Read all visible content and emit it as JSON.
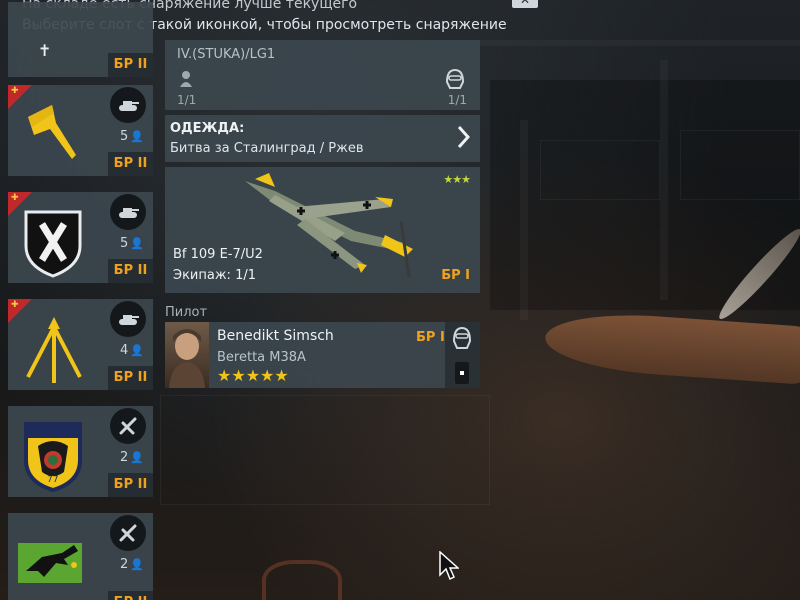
{
  "hint": {
    "line1": "На складе есть снаряжение лучше текущего",
    "line2": "Выберите слот с такой иконкой, чтобы просмотреть снаряжение"
  },
  "slots": [
    {
      "type_icon": "plane-icon",
      "br": "БР II",
      "crew": ""
    },
    {
      "type_icon": "tank-icon",
      "br": "БР II",
      "crew": "5",
      "emblem": "axe-emblem-icon"
    },
    {
      "type_icon": "tank-icon",
      "br": "БР II",
      "crew": "5",
      "emblem": "x-shield-emblem-icon"
    },
    {
      "type_icon": "tank-icon",
      "br": "БР II",
      "crew": "4",
      "emblem": "arrows-emblem-icon"
    },
    {
      "type_icon": "plane-icon",
      "br": "БР II",
      "crew": "2",
      "emblem": "eagle-shield-emblem-icon"
    },
    {
      "type_icon": "plane-icon",
      "br": "БР II",
      "crew": "2",
      "emblem": "bird-flag-emblem-icon"
    }
  ],
  "unit": {
    "name": "IV.(STUKA)/LG1",
    "left_count": "1/1",
    "right_count": "1/1"
  },
  "outfit": {
    "title": "ОДЕЖДА:",
    "subtitle": "Битва за Сталинград / Ржев"
  },
  "plane": {
    "name": "Bf 109 E-7/U2",
    "crew": "Экипаж: 1/1",
    "br": "БР I",
    "stars": "★★★"
  },
  "pilot": {
    "label": "Пилот",
    "name": "Benedikt Simsch",
    "weapon": "Beretta M38A",
    "br": "БР I",
    "stars": "★★★★★"
  },
  "colors": {
    "br_accent": "#f0a21e",
    "panel_bg": "#3c464e",
    "premium_corner": "#c0282a"
  }
}
